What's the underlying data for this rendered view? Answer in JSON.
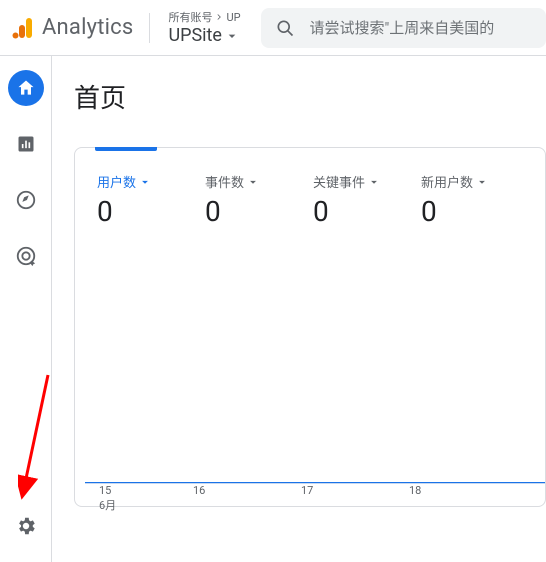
{
  "header": {
    "product_name": "Analytics",
    "breadcrumb_prefix": "所有账号",
    "breadcrumb_account": "UP",
    "property_name": "UPSite",
    "search_placeholder": "请尝试搜索\"上周来自美国的"
  },
  "sidebar": {
    "items": [
      {
        "name": "home-icon"
      },
      {
        "name": "reports-icon"
      },
      {
        "name": "explore-icon"
      },
      {
        "name": "advertising-icon"
      }
    ],
    "settings": "settings-icon"
  },
  "page": {
    "title": "首页"
  },
  "metrics": [
    {
      "label": "用户数",
      "value": "0",
      "active": true
    },
    {
      "label": "事件数",
      "value": "0",
      "active": false
    },
    {
      "label": "关键事件",
      "value": "0",
      "active": false
    },
    {
      "label": "新用户数",
      "value": "0",
      "active": false
    }
  ],
  "chart_data": {
    "type": "line",
    "title": "",
    "xlabel": "",
    "ylabel": "",
    "categories": [
      "15",
      "16",
      "17",
      "18"
    ],
    "x_sublabel": "6月",
    "series": [
      {
        "name": "用户数",
        "values": [
          0,
          0,
          0,
          0
        ]
      }
    ],
    "ylim": [
      0,
      1
    ]
  },
  "colors": {
    "accent": "#1a73e8",
    "logo_orange": "#f9ab00",
    "logo_red": "#e8710a",
    "text_secondary": "#5f6368",
    "arrow": "#ff0000"
  }
}
